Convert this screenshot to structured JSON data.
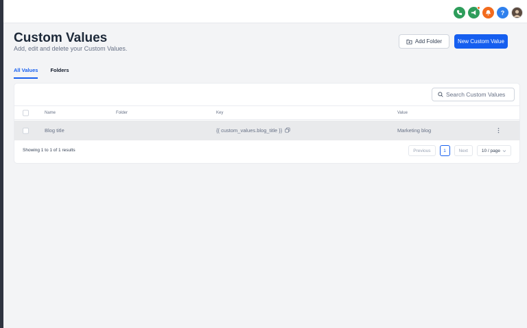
{
  "topbar": {
    "icons": [
      "phone-icon",
      "megaphone-icon",
      "bell-icon",
      "help-icon",
      "avatar"
    ],
    "help_glyph": "?"
  },
  "page": {
    "title": "Custom Values",
    "subtitle": "Add, edit and delete your Custom Values."
  },
  "actions": {
    "add_folder": "Add Folder",
    "new_custom_value": "New Custom Value"
  },
  "tabs": [
    {
      "label": "All Values",
      "active": true
    },
    {
      "label": "Folders",
      "active": false
    }
  ],
  "search": {
    "placeholder": "Search Custom Values"
  },
  "table": {
    "columns": [
      "Name",
      "Folder",
      "Key",
      "Value"
    ],
    "rows": [
      {
        "name": "Blog title",
        "folder": "",
        "key": "{{ custom_values.blog_title }}",
        "value": "Marketing blog"
      }
    ]
  },
  "footer": {
    "showing": "Showing 1 to 1 of 1 results",
    "previous": "Previous",
    "page": "1",
    "next": "Next",
    "page_size": "10 / page"
  },
  "colors": {
    "primary": "#155eef",
    "success": "#2e9d5b",
    "warning": "#f26b1d",
    "info": "#2f80ed"
  }
}
